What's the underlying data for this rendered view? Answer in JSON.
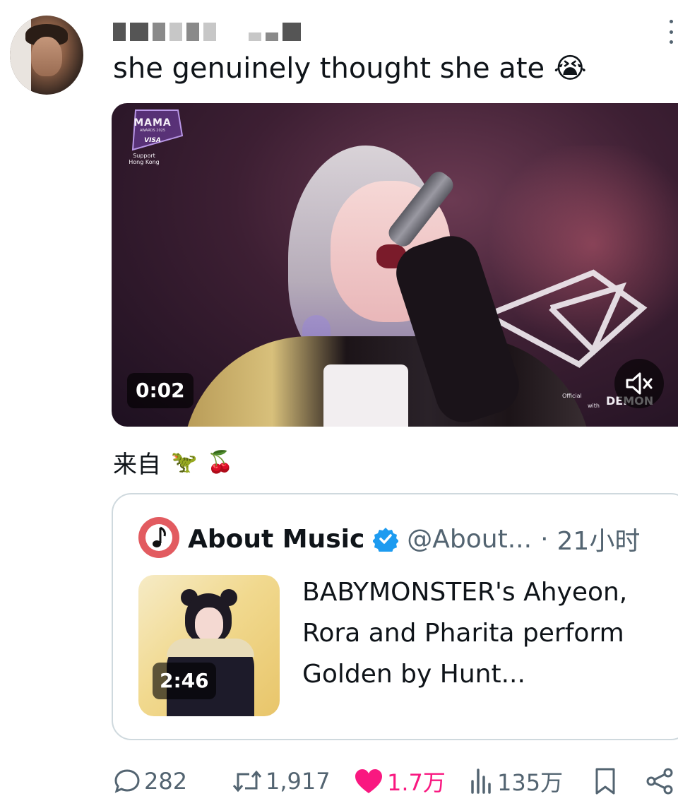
{
  "tweet": {
    "text": "she genuinely thought she ate",
    "text_emoji": "😭",
    "from_label": "来自",
    "from_emoji_1": "🦖",
    "from_emoji_2": "🍒"
  },
  "video": {
    "timestamp": "0:02",
    "logo_main": "MAMA",
    "logo_sub": "AWARDS 2025",
    "logo_visa": "VISA",
    "support_text_1": "Support",
    "support_text_2": "Hong Kong",
    "corner_text_1": "Official",
    "corner_text_2": "with",
    "corner_text_3": "DEMON",
    "mute_icon": "mute-icon"
  },
  "quote": {
    "name": "About Music",
    "handle": "@About...",
    "separator": "·",
    "time": "21小时",
    "text": "BABYMONSTER's Ahyeon, Rora and Pharita perform Golden by Hunt...",
    "thumb_duration": "2:46",
    "verified_color": "#1d9bf0",
    "avatar_color": "#e25b60"
  },
  "actions": {
    "replies": "282",
    "retweets": "1,917",
    "likes": "1.7万",
    "views": "135万",
    "like_color": "#f91880"
  }
}
